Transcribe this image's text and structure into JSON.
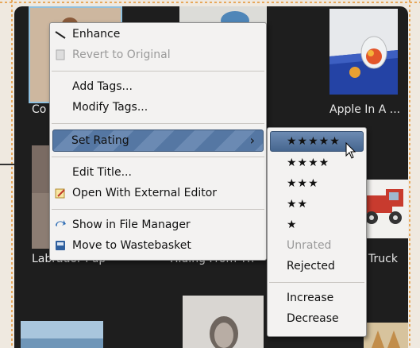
{
  "thumbnails": {
    "top_left_caption": "Co",
    "apple_caption": "Apple In A ...",
    "labrador_caption": "Labrador Pup",
    "hiding_caption": "Hiding From Th",
    "truck_caption": "Truck"
  },
  "context_menu": {
    "items": [
      {
        "label": "Enhance",
        "icon": "enhance-icon"
      },
      {
        "label": "Revert to Original",
        "icon": "revert-icon",
        "disabled": true
      },
      {
        "label": "Add Tags..."
      },
      {
        "label": "Modify Tags..."
      },
      {
        "label": "Set Rating",
        "submenu_arrow": "›"
      },
      {
        "label": "Edit Title..."
      },
      {
        "label": "Open With External Editor",
        "icon": "edit-icon"
      },
      {
        "label": "Show in File Manager",
        "icon": "show-folder-icon"
      },
      {
        "label": "Move to Wastebasket",
        "icon": "trash-icon"
      }
    ]
  },
  "rating_submenu": {
    "items": [
      {
        "label": "★★★★★"
      },
      {
        "label": "★★★★"
      },
      {
        "label": "★★★"
      },
      {
        "label": "★★"
      },
      {
        "label": "★"
      },
      {
        "label": "Unrated",
        "disabled": true
      },
      {
        "label": "Rejected"
      },
      {
        "label": "Increase"
      },
      {
        "label": "Decrease"
      }
    ]
  },
  "colors": {
    "viewer_background": "#1e1e1e",
    "menu_background": "#f3f2f1",
    "highlight": "#4f6f98",
    "border_dash": "#e7a85c"
  }
}
